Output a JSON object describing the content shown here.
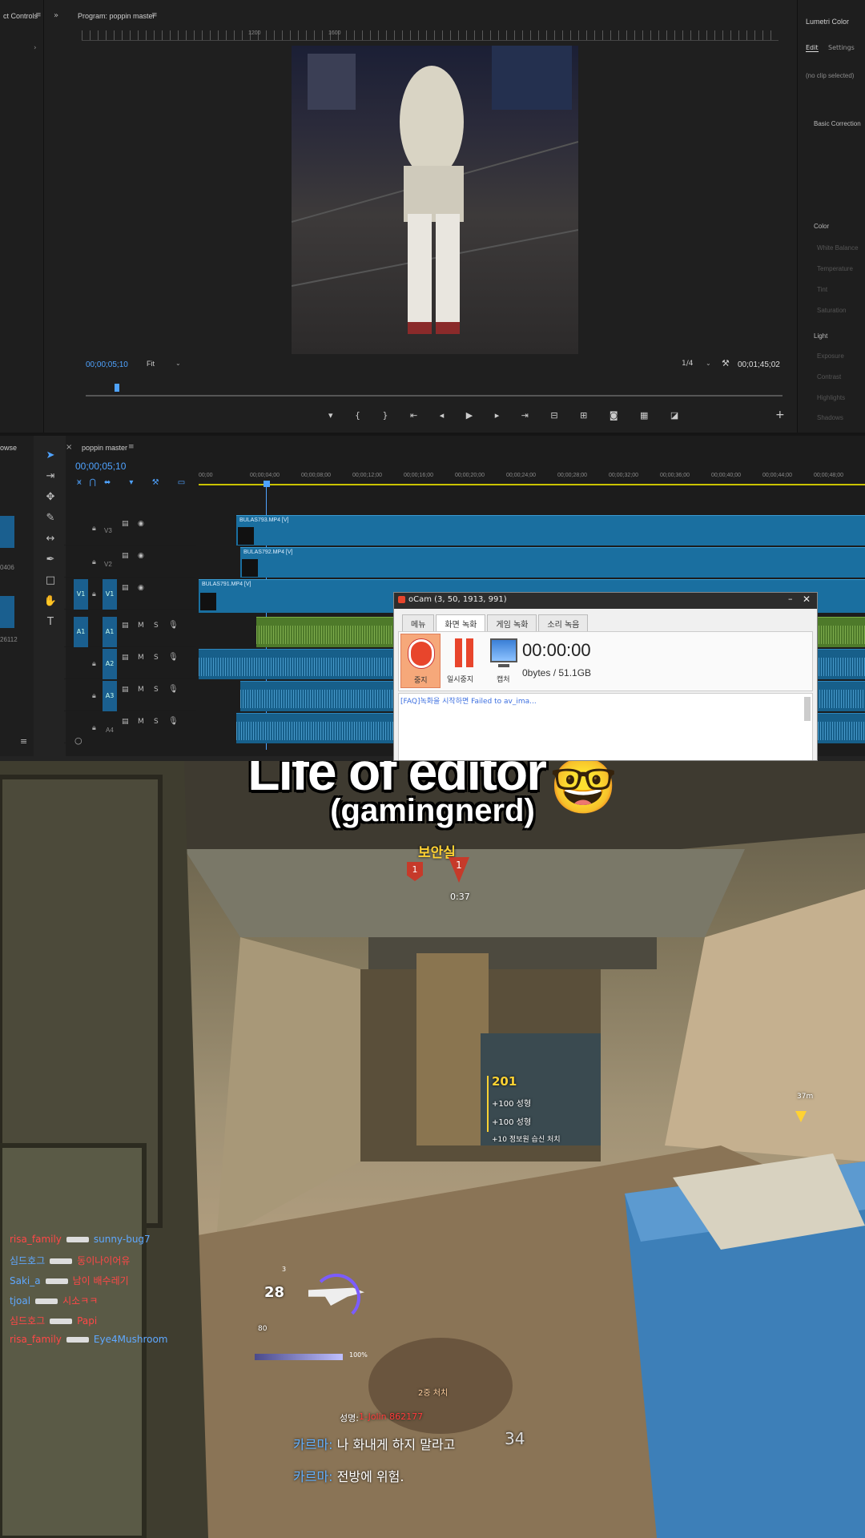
{
  "effect_controls": {
    "title": "ct Controls"
  },
  "program_monitor": {
    "title": "Program: poppin master",
    "ruler_labels": [
      "1200",
      "1600"
    ],
    "timecode": "00;00;05;10",
    "fit": "Fit",
    "resolution": "1/4",
    "duration": "00;01;45;02"
  },
  "lumetri": {
    "title": "Lumetri Color",
    "tabs": [
      "Edit",
      "Settings"
    ],
    "no_clip": "(no clip selected)",
    "sections": [
      "Basic Correction",
      "Color",
      "Light"
    ],
    "color_items": [
      "White Balance",
      "Temperature",
      "Tint",
      "Saturation"
    ],
    "light_items": [
      "Exposure",
      "Contrast",
      "Highlights",
      "Shadows"
    ]
  },
  "project_panel": {
    "title": "owse",
    "labels": [
      "0406",
      "26112"
    ]
  },
  "timeline": {
    "sequence_title": "poppin master",
    "timecode": "00;00;05;10",
    "ruler": [
      "00;00",
      "00;00;04;00",
      "00;00;08;00",
      "00;00;12;00",
      "00;00;16;00",
      "00;00;20;00",
      "00;00;24;00",
      "00;00;28;00",
      "00;00;32;00",
      "00;00;36;00",
      "00;00;40;00",
      "00;00;44;00",
      "00;00;48;00"
    ],
    "video_tracks": [
      "V3",
      "V2",
      "V1"
    ],
    "audio_tracks": [
      "A1",
      "A2",
      "A3",
      "A4"
    ],
    "source_v": "V1",
    "source_a": "A1",
    "clips": [
      "BULAS793.MP4 [V]",
      "BULAS792.MP4 [V]",
      "BULAS791.MP4 [V]"
    ]
  },
  "ocam": {
    "title": "oCam (3, 50, 1913, 991)",
    "tabs": [
      "메뉴",
      "화면 녹화",
      "게임 녹화",
      "소리 녹음"
    ],
    "buttons": {
      "stop": "중지",
      "pause": "일시중지",
      "capture": "캡처"
    },
    "timer": "00:00:00",
    "size": "0bytes / 51.1GB",
    "log": "[FAQ]녹화을 시작하면 Failed to av_ima..."
  },
  "caption": {
    "title": "Life of editor",
    "emoji": "🤓",
    "subtitle": "(gamingnerd)"
  },
  "game": {
    "objective_label": "보안실",
    "markers": [
      "1",
      "1"
    ],
    "objective_timer": "0:37",
    "score_total": "201",
    "score_lines": [
      "+100 성형",
      "+100 성형",
      "+10 정보원 습신 처치"
    ],
    "distance": "37m",
    "killfeed": [
      {
        "killer": "risa_family",
        "victim": "sunny-bug7",
        "kc": "kf-red",
        "vc": "kf-blue"
      },
      {
        "killer": "심드호그",
        "victim": "동이나이어유",
        "kc": "kf-blue",
        "vc": "kf-red"
      },
      {
        "killer": "Saki_a",
        "victim": "남이 배수레기",
        "kc": "kf-blue",
        "vc": "kf-red"
      },
      {
        "killer": "tjoal",
        "victim": "시소ㅋㅋ",
        "kc": "kf-blue",
        "vc": "kf-red"
      },
      {
        "killer": "심드호그",
        "victim": "Papi",
        "kc": "kf-red",
        "vc": "kf-red"
      },
      {
        "killer": "risa_family",
        "victim": "Eye4Mushroom",
        "kc": "kf-red",
        "vc": "kf-blue"
      }
    ],
    "ammo": "28",
    "ammo_reserve": "80",
    "tactical": "3",
    "health_pct": "100%",
    "center_label": "2중 처치",
    "chat_name_label": "성명:",
    "chat_name_value": "1-Jolin 862177",
    "chat": [
      {
        "name": "카르마:",
        "text": "나 화내게 하지 말라고"
      },
      {
        "name": "카르마:",
        "text": "전방에 위험."
      }
    ],
    "right_count": "34"
  },
  "colors": {
    "accent": "#4fa3ff",
    "rec_red": "#e8452c",
    "timeline_clip": "#1a6fa0"
  }
}
